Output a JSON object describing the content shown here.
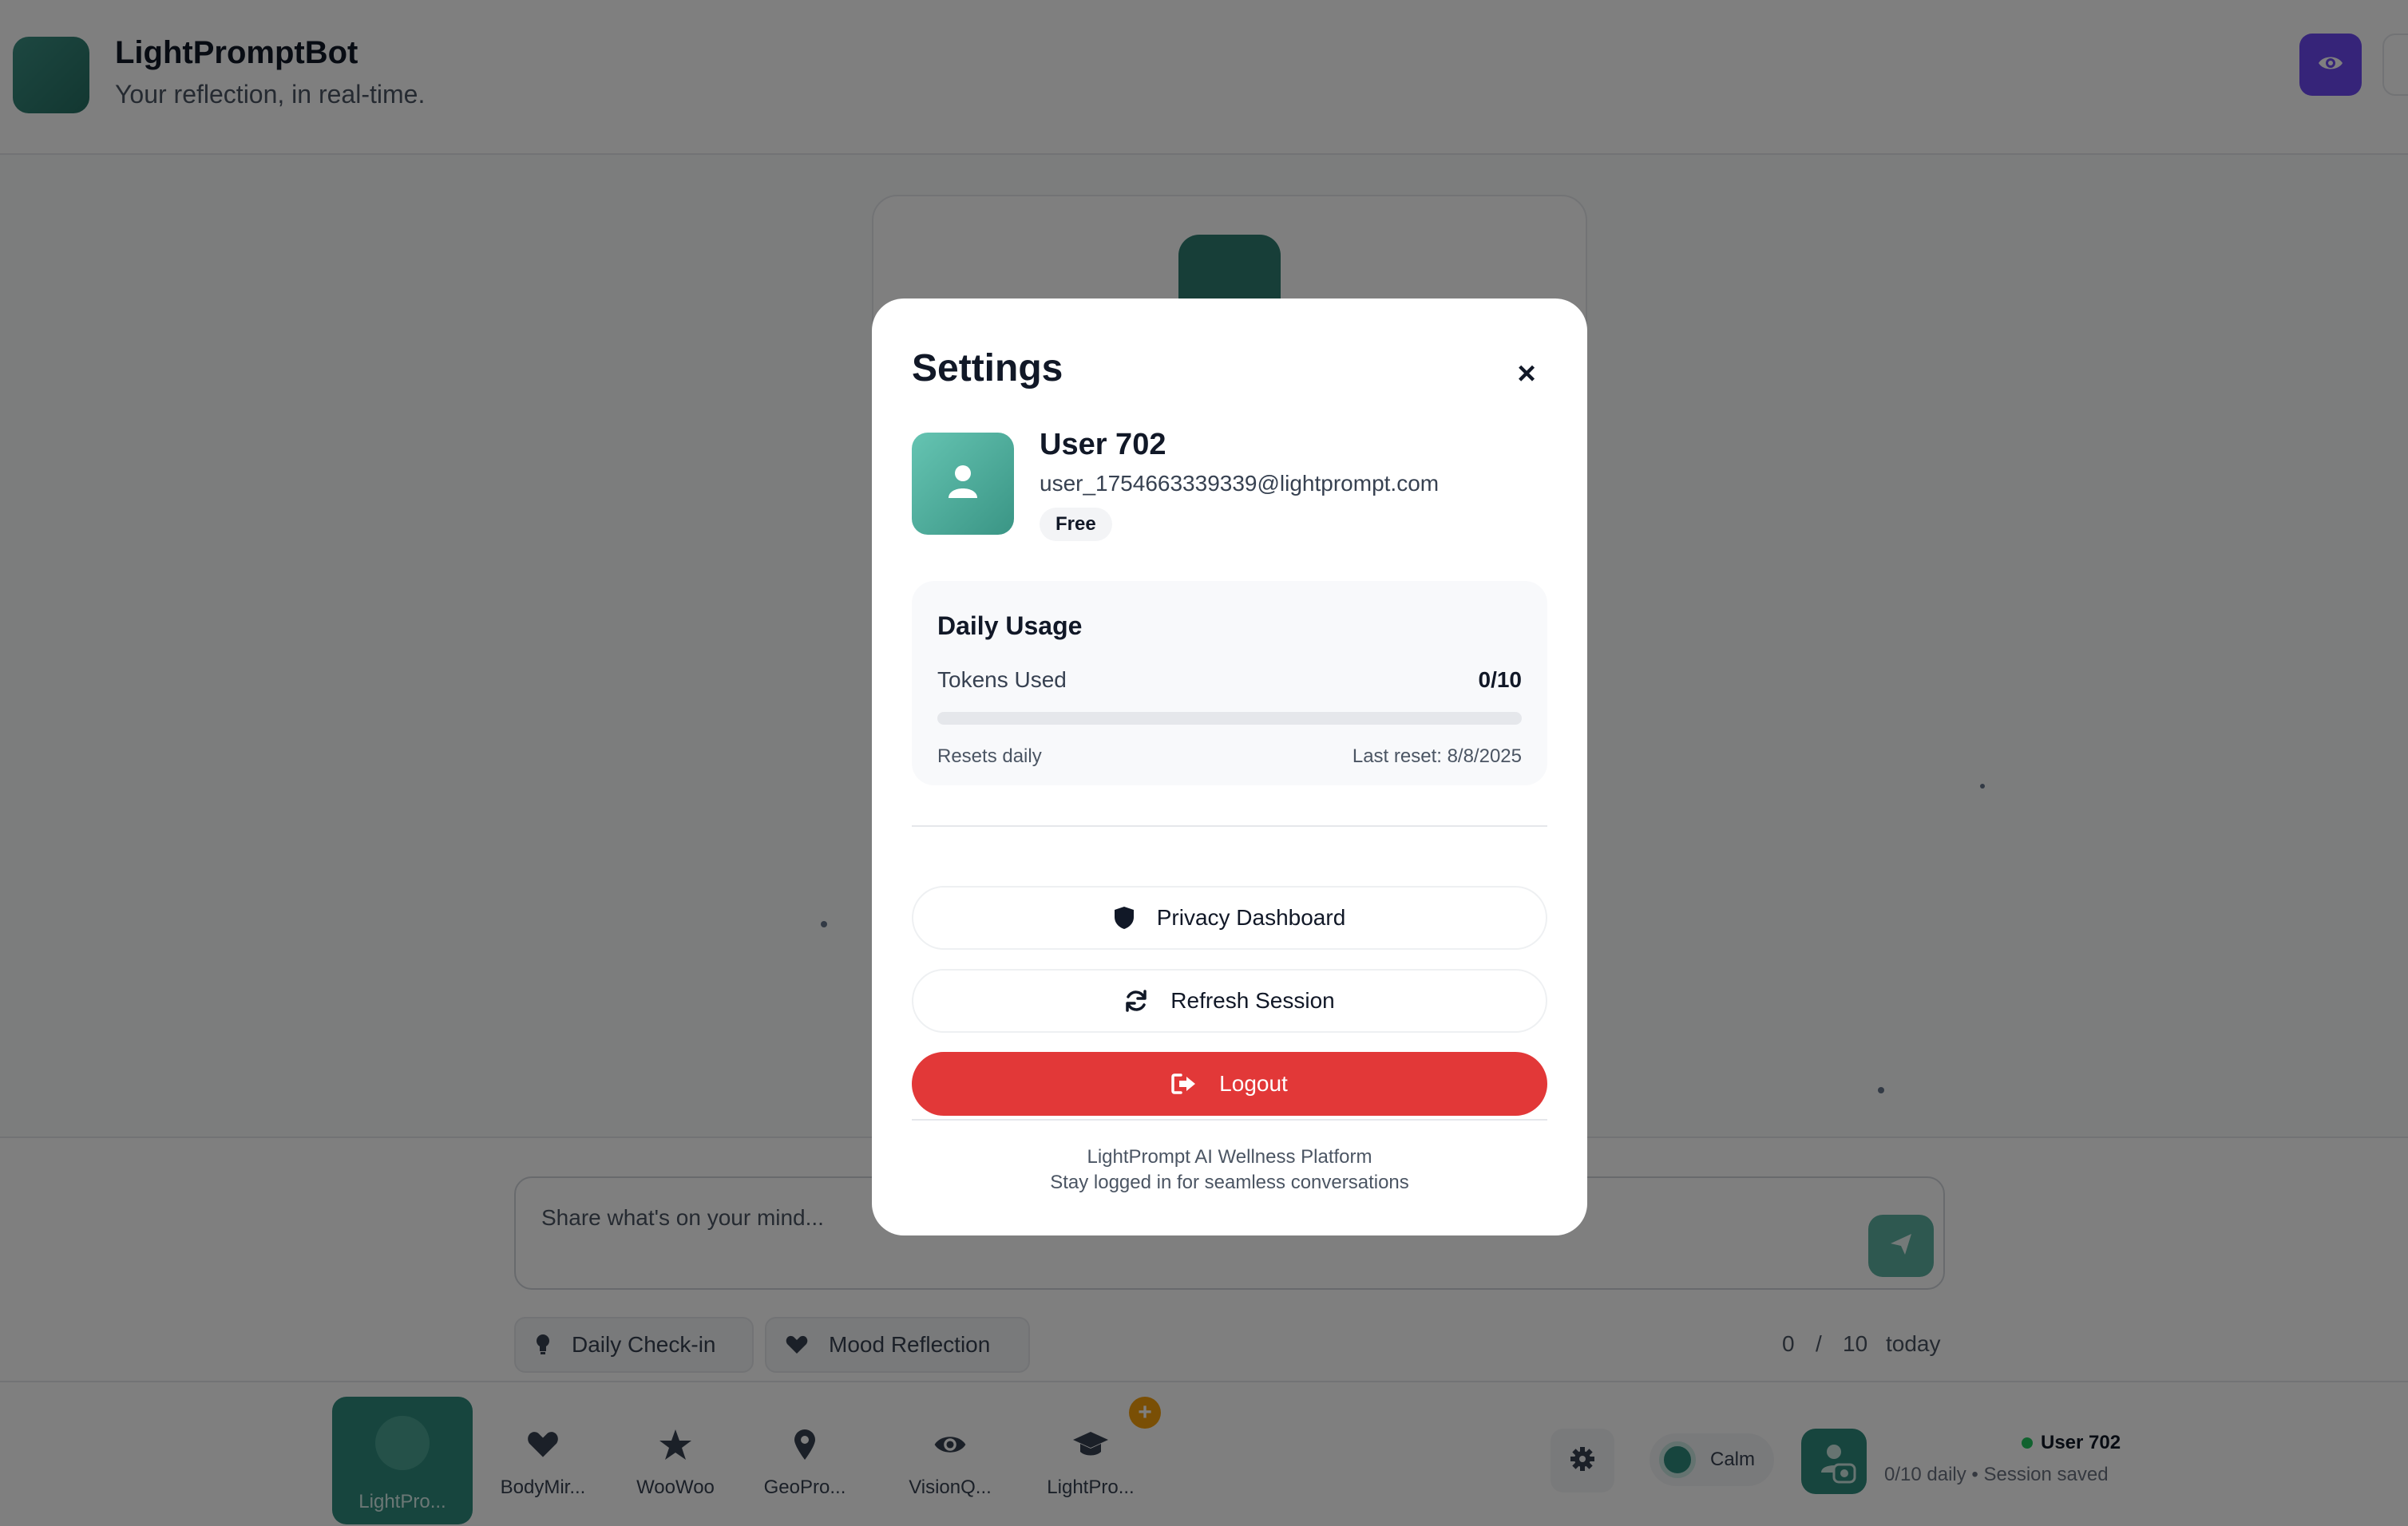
{
  "header": {
    "title": "LightPromptBot",
    "subtitle": "Your reflection, in real-time.",
    "view_icon": "eye-icon"
  },
  "chat": {
    "placeholder": "Share what's on your mind...",
    "send_icon": "send-icon",
    "chips": [
      {
        "label": "Daily Check-in",
        "icon": "lightbulb-icon"
      },
      {
        "label": "Mood Reflection",
        "icon": "heart-icon"
      }
    ],
    "counter": {
      "used": "0",
      "sep": "/",
      "limit": "10",
      "suffix": "today"
    }
  },
  "bottom_nav": {
    "items": [
      {
        "label": "LightPro...",
        "icon": "circle-icon",
        "active": true
      },
      {
        "label": "BodyMir...",
        "icon": "heart-icon"
      },
      {
        "label": "WooWoo",
        "icon": "star-icon"
      },
      {
        "label": "GeoPro...",
        "icon": "map-pin-icon"
      },
      {
        "label": "VisionQ...",
        "icon": "eye-icon"
      },
      {
        "label": "LightPro...",
        "icon": "graduation-cap-icon",
        "badge": "+"
      }
    ],
    "mood": "Calm",
    "user_name": "User 702",
    "user_status": "0/10 daily • Session saved"
  },
  "settings": {
    "title": "Settings",
    "close_label": "×",
    "user": {
      "name": "User 702",
      "email": "user_1754663339339@lightprompt.com",
      "plan": "Free"
    },
    "usage": {
      "title": "Daily Usage",
      "tokens_label": "Tokens Used",
      "tokens_value": "0/10",
      "tokens_fraction": 0,
      "resets": "Resets daily",
      "last_reset": "Last reset: 8/8/2025"
    },
    "buttons": {
      "privacy": "Privacy Dashboard",
      "refresh": "Refresh Session",
      "logout": "Logout"
    },
    "footer": {
      "line1": "LightPrompt AI Wellness Platform",
      "line2": "Stay logged in for seamless conversations"
    }
  },
  "colors": {
    "accent": "#2e8b7d",
    "logout": "#e23838",
    "view_button": "#6d48f2"
  }
}
